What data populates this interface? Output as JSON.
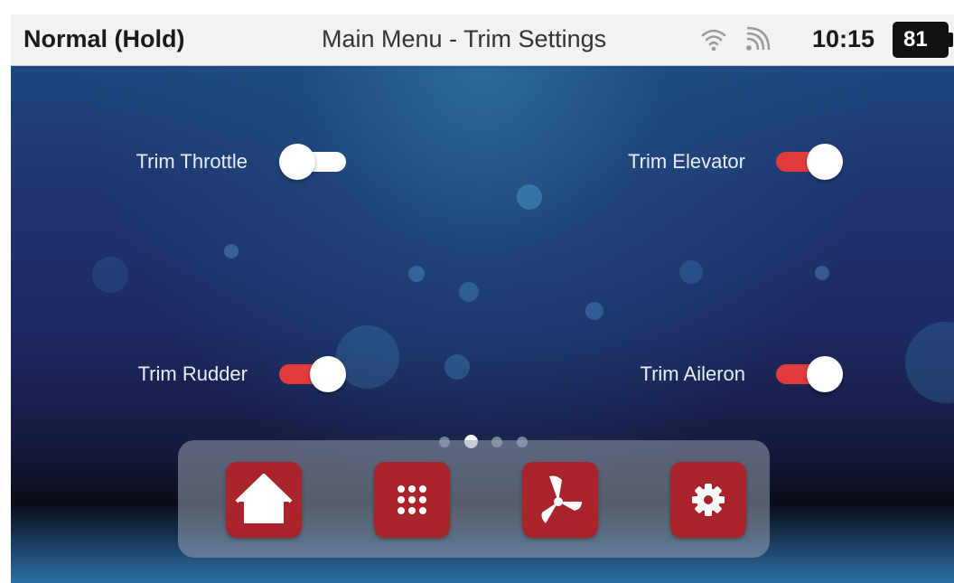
{
  "status_bar": {
    "mode": "Normal (Hold)",
    "title": "Main Menu - Trim Settings",
    "wifi_icon": "wifi-icon",
    "signal_icon": "rss-signal-icon",
    "time": "10:15",
    "battery": "81"
  },
  "trims": [
    {
      "label": "Trim Throttle",
      "on": false
    },
    {
      "label": "Trim Elevator",
      "on": true
    },
    {
      "label": "Trim Rudder",
      "on": true
    },
    {
      "label": "Trim Aileron",
      "on": true
    }
  ],
  "pager": {
    "count": 4,
    "active": 1
  },
  "dock": [
    {
      "icon": "home-icon"
    },
    {
      "icon": "grid-apps-icon"
    },
    {
      "icon": "propeller-icon"
    },
    {
      "icon": "gear-icon"
    }
  ],
  "colors": {
    "toggle_on": "#e23b3b",
    "toggle_off": "#ffffff",
    "dock_button": "#a8232a",
    "status_bar": "#f2f2f2"
  }
}
